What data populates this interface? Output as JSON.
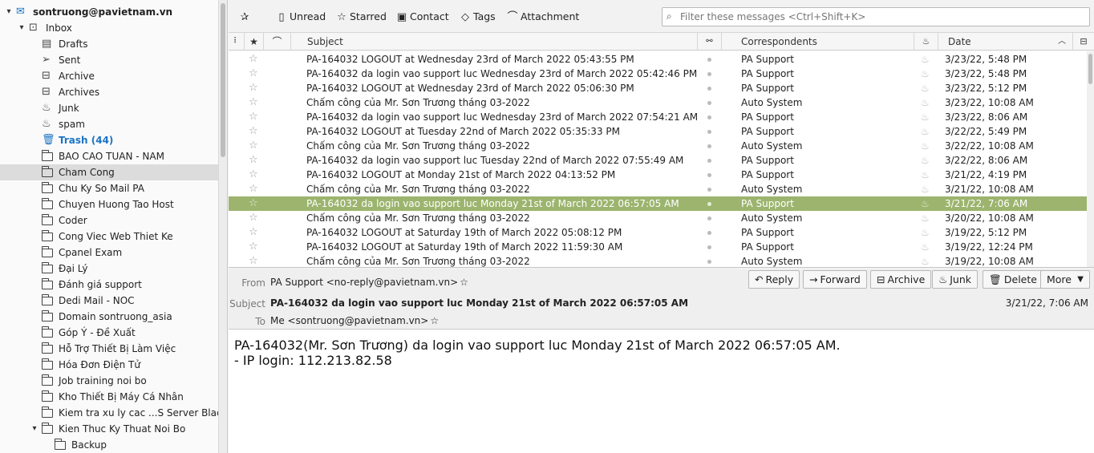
{
  "folders": [
    {
      "label": "sontruong@pavietnam.vn",
      "icon": "mail-account-icon",
      "name": "folder-account",
      "level": 0,
      "twisty": "▾",
      "style": "bold"
    },
    {
      "label": "Inbox",
      "icon": "inbox-icon",
      "name": "folder-inbox",
      "level": 1,
      "twisty": "▾"
    },
    {
      "label": "Drafts",
      "icon": "drafts-icon",
      "name": "folder-drafts",
      "level": 2
    },
    {
      "label": "Sent",
      "icon": "sent-icon",
      "name": "folder-sent",
      "level": 2
    },
    {
      "label": "Archive",
      "icon": "archive-icon",
      "name": "folder-archive",
      "level": 2
    },
    {
      "label": "Archives",
      "icon": "archive-icon",
      "name": "folder-archives",
      "level": 2
    },
    {
      "label": "Junk",
      "icon": "junk-icon",
      "name": "folder-junk",
      "level": 2
    },
    {
      "label": "spam",
      "icon": "junk-icon",
      "name": "folder-spam",
      "level": 2
    },
    {
      "label": "Trash (44)",
      "icon": "trash-icon",
      "name": "folder-trash",
      "level": 2,
      "style": "blue"
    },
    {
      "label": "BAO CAO TUAN - NAM",
      "icon": "folder-icon",
      "name": "folder-item",
      "level": 2
    },
    {
      "label": "Cham Cong",
      "icon": "folder-icon",
      "name": "folder-item",
      "level": 2,
      "selected": true
    },
    {
      "label": "Chu Ky So Mail PA",
      "icon": "folder-icon",
      "name": "folder-item",
      "level": 2
    },
    {
      "label": "Chuyen Huong Tao Host",
      "icon": "folder-icon",
      "name": "folder-item",
      "level": 2
    },
    {
      "label": "Coder",
      "icon": "folder-icon",
      "name": "folder-item",
      "level": 2
    },
    {
      "label": "Cong Viec Web Thiet Ke",
      "icon": "folder-icon",
      "name": "folder-item",
      "level": 2
    },
    {
      "label": "Cpanel Exam",
      "icon": "folder-icon",
      "name": "folder-item",
      "level": 2
    },
    {
      "label": "Đại Lý",
      "icon": "folder-icon",
      "name": "folder-item",
      "level": 2
    },
    {
      "label": "Đánh giá support",
      "icon": "folder-icon",
      "name": "folder-item",
      "level": 2
    },
    {
      "label": "Dedi Mail - NOC",
      "icon": "folder-icon",
      "name": "folder-item",
      "level": 2
    },
    {
      "label": "Domain sontruong_asia",
      "icon": "folder-icon",
      "name": "folder-item",
      "level": 2
    },
    {
      "label": "Góp Ý - Đề Xuất",
      "icon": "folder-icon",
      "name": "folder-item",
      "level": 2
    },
    {
      "label": "Hỗ Trợ Thiết Bị Làm Việc",
      "icon": "folder-icon",
      "name": "folder-item",
      "level": 2
    },
    {
      "label": "Hóa Đơn Điện Tử",
      "icon": "folder-icon",
      "name": "folder-item",
      "level": 2
    },
    {
      "label": "Job training noi bo",
      "icon": "folder-icon",
      "name": "folder-item",
      "level": 2
    },
    {
      "label": "Kho Thiết Bị Máy Cá Nhân",
      "icon": "folder-icon",
      "name": "folder-item",
      "level": 2
    },
    {
      "label": "Kiem tra xu ly cac ...S Server Blacklist",
      "icon": "folder-icon",
      "name": "folder-item",
      "level": 2
    },
    {
      "label": "Kien Thuc Ky Thuat Noi Bo",
      "icon": "folder-icon",
      "name": "folder-item",
      "level": 2,
      "twisty": "▾"
    },
    {
      "label": "Backup",
      "icon": "folder-icon",
      "name": "folder-item",
      "level": 3
    }
  ],
  "toolbar": {
    "unread": "Unread",
    "starred": "Starred",
    "contact": "Contact",
    "tags": "Tags",
    "attachment": "Attachment",
    "filter_placeholder": "Filter these messages <Ctrl+Shift+K>"
  },
  "columns": {
    "subject": "Subject",
    "correspondents": "Correspondents",
    "date": "Date"
  },
  "messages": [
    {
      "subject": "PA-164032 LOGOUT at Wednesday 23rd of March 2022 05:43:55 PM",
      "from": "PA Support",
      "date": "3/23/22, 5:48 PM"
    },
    {
      "subject": "PA-164032 da login vao support luc Wednesday 23rd of March 2022 05:42:46 PM",
      "from": "PA Support",
      "date": "3/23/22, 5:48 PM"
    },
    {
      "subject": "PA-164032 LOGOUT at Wednesday 23rd of March 2022 05:06:30 PM",
      "from": "PA Support",
      "date": "3/23/22, 5:12 PM"
    },
    {
      "subject": "Chấm công của Mr. Sơn Trương tháng 03-2022",
      "from": "Auto System",
      "date": "3/23/22, 10:08 AM"
    },
    {
      "subject": "PA-164032 da login vao support luc Wednesday 23rd of March 2022 07:54:21 AM",
      "from": "PA Support",
      "date": "3/23/22, 8:06 AM"
    },
    {
      "subject": "PA-164032 LOGOUT at Tuesday 22nd of March 2022 05:35:33 PM",
      "from": "PA Support",
      "date": "3/22/22, 5:49 PM"
    },
    {
      "subject": "Chấm công của Mr. Sơn Trương tháng 03-2022",
      "from": "Auto System",
      "date": "3/22/22, 10:08 AM"
    },
    {
      "subject": "PA-164032 da login vao support luc Tuesday 22nd of March 2022 07:55:49 AM",
      "from": "PA Support",
      "date": "3/22/22, 8:06 AM"
    },
    {
      "subject": "PA-164032 LOGOUT at Monday 21st of March 2022 04:13:52 PM",
      "from": "PA Support",
      "date": "3/21/22, 4:19 PM"
    },
    {
      "subject": "Chấm công của Mr. Sơn Trương tháng 03-2022",
      "from": "Auto System",
      "date": "3/21/22, 10:08 AM"
    },
    {
      "subject": "PA-164032 da login vao support luc Monday 21st of March 2022 06:57:05 AM",
      "from": "PA Support",
      "date": "3/21/22, 7:06 AM",
      "selected": true
    },
    {
      "subject": "Chấm công của Mr. Sơn Trương tháng 03-2022",
      "from": "Auto System",
      "date": "3/20/22, 10:08 AM"
    },
    {
      "subject": "PA-164032 LOGOUT at Saturday 19th of March 2022 05:08:12 PM",
      "from": "PA Support",
      "date": "3/19/22, 5:12 PM"
    },
    {
      "subject": "PA-164032 LOGOUT at Saturday 19th of March 2022 11:59:30 AM",
      "from": "PA Support",
      "date": "3/19/22, 12:24 PM"
    },
    {
      "subject": "Chấm công của Mr. Sơn Trương tháng 03-2022",
      "from": "Auto System",
      "date": "3/19/22, 10:08 AM"
    }
  ],
  "header": {
    "from_label": "From",
    "from_value": "PA Support <no-reply@pavietnam.vn>",
    "subject_label": "Subject",
    "subject_value": "PA-164032 da login vao support luc Monday 21st of March 2022 06:57:05 AM",
    "to_label": "To",
    "to_value": "Me <sontruong@pavietnam.vn>",
    "date": "3/21/22, 7:06 AM",
    "actions": {
      "reply": "Reply",
      "forward": "Forward",
      "archive": "Archive",
      "junk": "Junk",
      "delete": "Delete",
      "more": "More"
    }
  },
  "body": {
    "line1": "PA-164032(Mr. Sơn Trương) da login vao support luc Monday 21st of March 2022 06:57:05 AM.",
    "line2": "- IP login: 112.213.82.58"
  },
  "colors": {
    "selected_row": "#9cb46e",
    "selected_folder": "#dcdcdc",
    "trash_blue": "#1c74c4"
  }
}
